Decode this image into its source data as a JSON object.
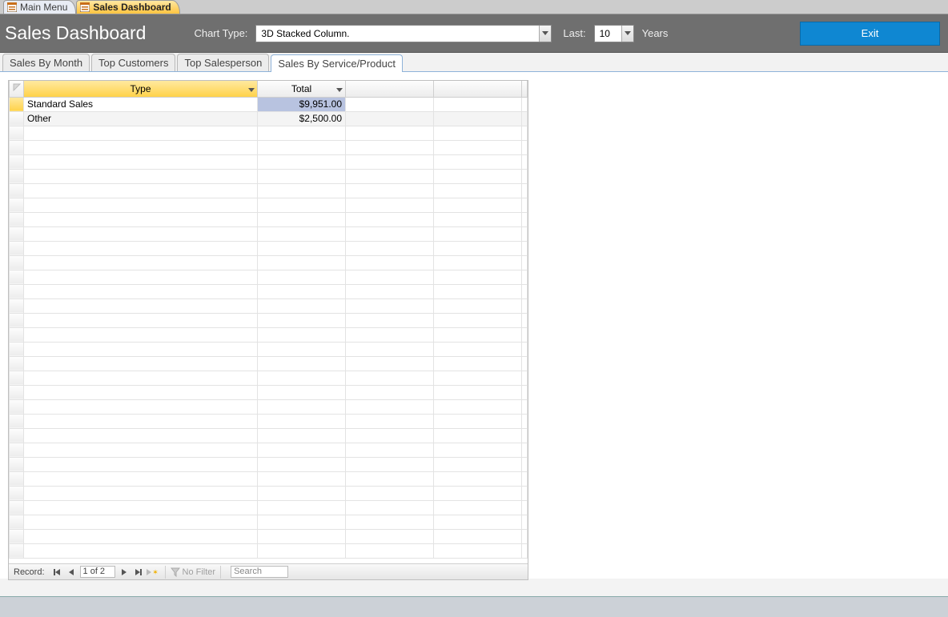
{
  "doc_tabs": {
    "main_menu": "Main Menu",
    "sales_dashboard": "Sales Dashboard"
  },
  "header": {
    "title": "Sales Dashboard",
    "chart_type_label": "Chart Type:",
    "chart_type_value": "3D Stacked Column.",
    "last_label": "Last:",
    "last_value": "10",
    "years_label": "Years",
    "exit_label": "Exit"
  },
  "inner_tabs": {
    "t0": "Sales By Month",
    "t1": "Top Customers",
    "t2": "Top Salesperson",
    "t3": "Sales By Service/Product"
  },
  "grid": {
    "col_type": "Type",
    "col_total": "Total",
    "rows": [
      {
        "type": "Standard Sales",
        "total": "$9,951.00"
      },
      {
        "type": "Other",
        "total": "$2,500.00"
      }
    ]
  },
  "record_nav": {
    "label": "Record:",
    "position": "1 of 2",
    "no_filter": "No Filter",
    "search": "Search"
  },
  "chart_data": {
    "type": "table",
    "columns": [
      "Type",
      "Total"
    ],
    "rows": [
      [
        "Standard Sales",
        9951.0
      ],
      [
        "Other",
        2500.0
      ]
    ]
  }
}
